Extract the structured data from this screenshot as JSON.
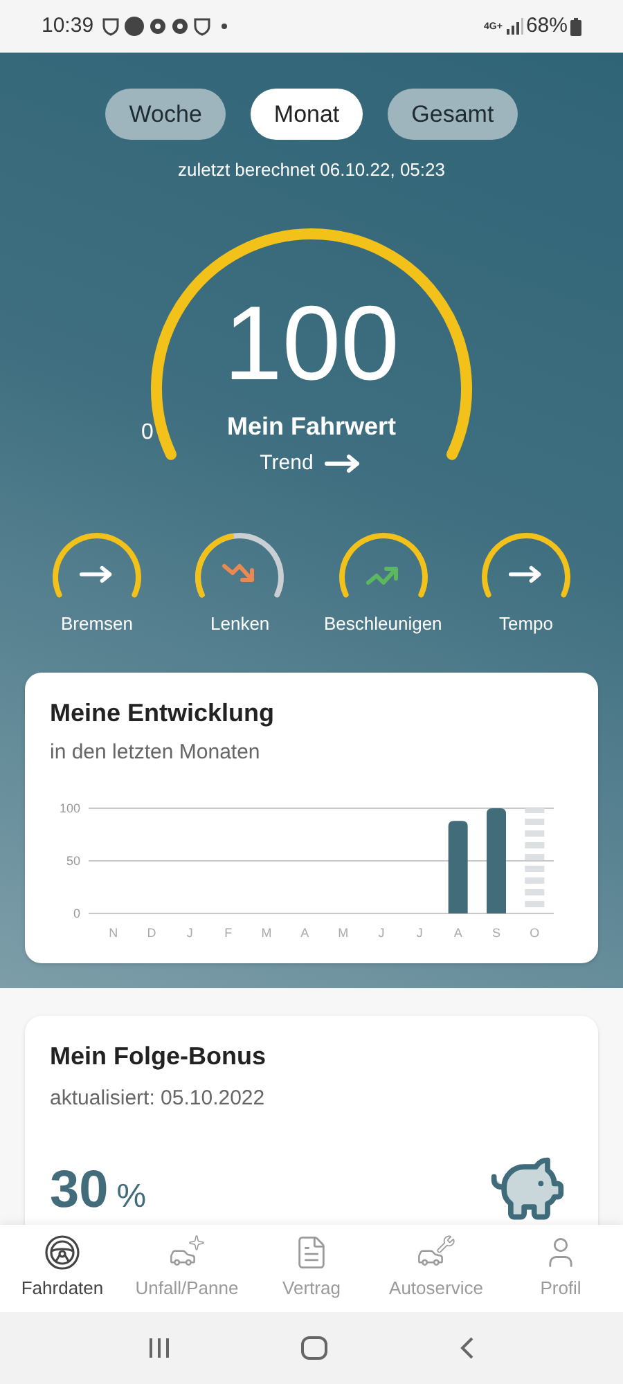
{
  "status_bar": {
    "time": "10:39",
    "network": "4G+",
    "battery": "68%"
  },
  "period_tabs": [
    {
      "label": "Woche",
      "selected": false
    },
    {
      "label": "Monat",
      "selected": true
    },
    {
      "label": "Gesamt",
      "selected": false
    }
  ],
  "last_calculated": "zuletzt berechnet 06.10.22, 05:23",
  "score_gauge": {
    "value": "100",
    "label": "Mein Fahrwert",
    "min_label": "0",
    "trend_label": "Trend"
  },
  "categories": [
    {
      "label": "Bremsen",
      "kind": "flat"
    },
    {
      "label": "Lenken",
      "kind": "down"
    },
    {
      "label": "Beschleunigen",
      "kind": "up"
    },
    {
      "label": "Tempo",
      "kind": "flat"
    }
  ],
  "development_card": {
    "title": "Meine Entwicklung",
    "subtitle": "in den letzten Monaten",
    "chart_data": {
      "type": "bar",
      "categories": [
        "N",
        "D",
        "J",
        "F",
        "M",
        "A",
        "M",
        "J",
        "J",
        "A",
        "S",
        "O"
      ],
      "ylim": [
        0,
        100
      ],
      "yticks": [
        0,
        50,
        100
      ],
      "stacked": true,
      "series": [
        {
          "color": "#436c7b",
          "values": [
            0,
            0,
            0,
            0,
            0,
            0,
            0,
            0,
            0,
            88,
            100,
            null
          ]
        },
        {
          "color": "#dde0e2",
          "values": [
            null,
            null,
            null,
            null,
            null,
            null,
            null,
            null,
            null,
            null,
            null,
            100
          ]
        }
      ]
    }
  },
  "bonus_card": {
    "title": "Mein Folge-Bonus",
    "updated": "aktualisiert: 05.10.2022",
    "value": "30",
    "unit": "%"
  },
  "bottom_nav": [
    {
      "label": "Fahrdaten",
      "kind": "wheel",
      "selected": true
    },
    {
      "label": "Unfall/Panne",
      "kind": "crash",
      "selected": false
    },
    {
      "label": "Vertrag",
      "kind": "contract",
      "selected": false
    },
    {
      "label": "Autoservice",
      "kind": "service",
      "selected": false
    },
    {
      "label": "Profil",
      "kind": "profile",
      "selected": false
    }
  ]
}
